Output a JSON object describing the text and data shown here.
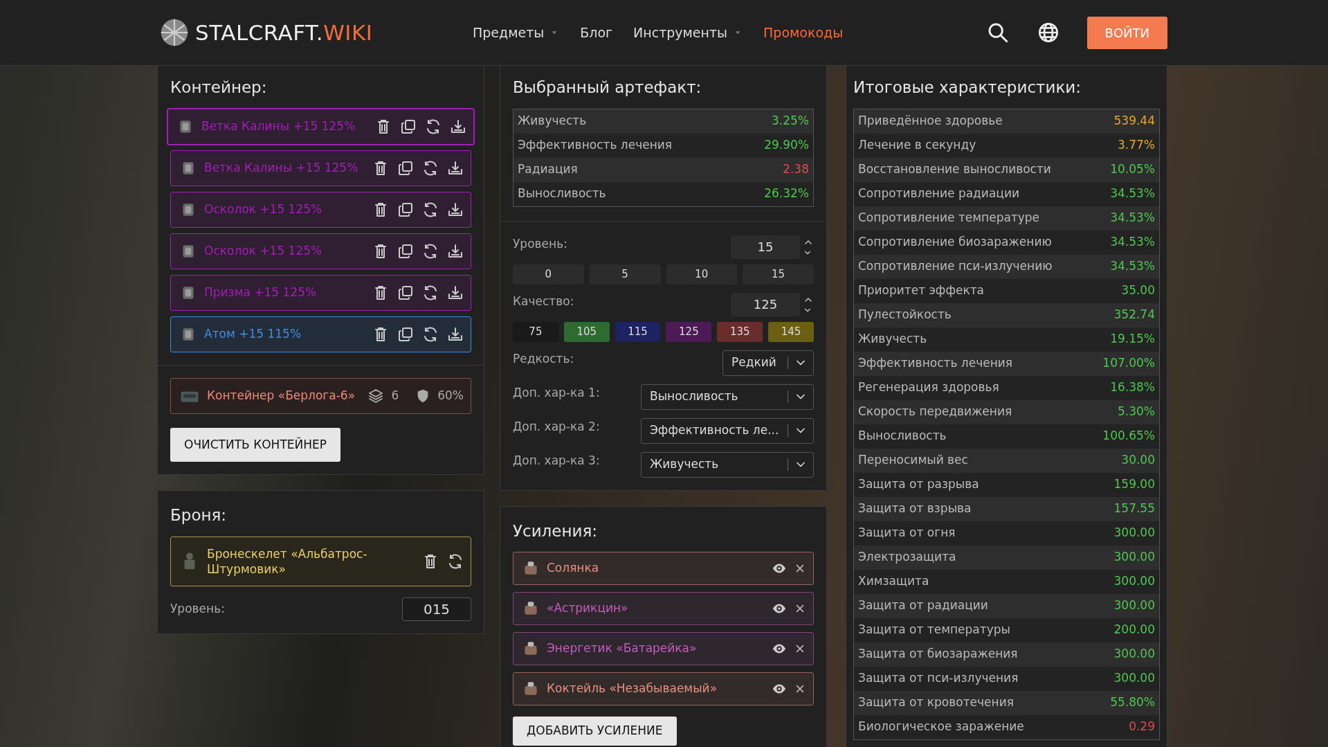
{
  "header": {
    "logo_main": "STALCRAFT.",
    "logo_accent": "WIKI",
    "nav": [
      {
        "label": "Предметы",
        "dropdown": true,
        "highlighted": false
      },
      {
        "label": "Блог",
        "dropdown": false,
        "highlighted": false
      },
      {
        "label": "Инструменты",
        "dropdown": true,
        "highlighted": false
      },
      {
        "label": "Промокоды",
        "dropdown": false,
        "highlighted": true
      }
    ],
    "login": "ВОЙТИ"
  },
  "container": {
    "title": "Контейнер:",
    "items": [
      {
        "name": "Ветка Калины +15 125%",
        "color": "#a21fb5",
        "selected": true
      },
      {
        "name": "Ветка Калины +15 125%",
        "color": "#a21fb5",
        "selected": false
      },
      {
        "name": "Осколок +15 125%",
        "color": "#a21fb5",
        "selected": false
      },
      {
        "name": "Осколок +15 125%",
        "color": "#a21fb5",
        "selected": false
      },
      {
        "name": "Призма +15 125%",
        "color": "#a21fb5",
        "selected": false
      },
      {
        "name": "Атом +15 115%",
        "color": "#3f8ce6",
        "selected": false
      }
    ],
    "box": {
      "name": "Контейнер «Берлога-6»",
      "slots": "6",
      "protection": "60%"
    },
    "clear_button": "ОЧИСТИТЬ КОНТЕЙНЕР"
  },
  "armor": {
    "title": "Броня:",
    "item": "Бронескелет «Альбатрос-Штурмовик»",
    "level_label": "Уровень:",
    "level_value": "015"
  },
  "artifact": {
    "title": "Выбранный артефакт:",
    "stats": [
      {
        "label": "Живучесть",
        "value": "3.25%",
        "kind": "good"
      },
      {
        "label": "Эффективность лечения",
        "value": "29.90%",
        "kind": "good"
      },
      {
        "label": "Радиация",
        "value": "2.38",
        "kind": "bad"
      },
      {
        "label": "Выносливость",
        "value": "26.32%",
        "kind": "good"
      }
    ],
    "level": {
      "label": "Уровень:",
      "value": "15",
      "presets": [
        "0",
        "5",
        "10",
        "15"
      ]
    },
    "quality": {
      "label": "Качество:",
      "value": "125",
      "presets": [
        {
          "label": "75",
          "color": "#1a1a1a"
        },
        {
          "label": "105",
          "color": "#2e6b30"
        },
        {
          "label": "115",
          "color": "#1d2263"
        },
        {
          "label": "125",
          "color": "#4c1a57"
        },
        {
          "label": "135",
          "color": "#6b2c2c"
        },
        {
          "label": "145",
          "color": "#6b5f12"
        }
      ]
    },
    "rarity": {
      "label": "Редкость:",
      "value": "Редкий"
    },
    "extras": [
      {
        "label": "Доп. хар-ка 1:",
        "value": "Выносливость"
      },
      {
        "label": "Доп. хар-ка 2:",
        "value": "Эффективность ле..."
      },
      {
        "label": "Доп. хар-ка 3:",
        "value": "Живучесть"
      }
    ]
  },
  "boosts": {
    "title": "Усиления:",
    "items": [
      {
        "name": "Солянка",
        "color": "#e8907e"
      },
      {
        "name": "«Астрикцин»",
        "color": "#c45cbc"
      },
      {
        "name": "Энергетик «Батарейка»",
        "color": "#c45cbc"
      },
      {
        "name": "Коктейль «Незабываемый»",
        "color": "#e8907e"
      }
    ],
    "add_button": "ДОБАВИТЬ УСИЛЕНИЕ"
  },
  "totals": {
    "title": "Итоговые характеристики:",
    "stats": [
      {
        "label": "Приведённое здоровье",
        "value": "539.44",
        "kind": "gold"
      },
      {
        "label": "Лечение в секунду",
        "value": "3.77%",
        "kind": "gold"
      },
      {
        "label": "Восстановление выносливости",
        "value": "10.05%",
        "kind": "good"
      },
      {
        "label": "Сопротивление радиации",
        "value": "34.53%",
        "kind": "good"
      },
      {
        "label": "Сопротивление температуре",
        "value": "34.53%",
        "kind": "good"
      },
      {
        "label": "Сопротивление биозаражению",
        "value": "34.53%",
        "kind": "good"
      },
      {
        "label": "Сопротивление пси-излучению",
        "value": "34.53%",
        "kind": "good"
      },
      {
        "label": "Приоритет эффекта",
        "value": "35.00",
        "kind": "good"
      },
      {
        "label": "Пулестойкость",
        "value": "352.74",
        "kind": "good"
      },
      {
        "label": "Живучесть",
        "value": "19.15%",
        "kind": "good"
      },
      {
        "label": "Эффективность лечения",
        "value": "107.00%",
        "kind": "good"
      },
      {
        "label": "Регенерация здоровья",
        "value": "16.38%",
        "kind": "good"
      },
      {
        "label": "Скорость передвижения",
        "value": "5.30%",
        "kind": "good"
      },
      {
        "label": "Выносливость",
        "value": "100.65%",
        "kind": "good"
      },
      {
        "label": "Переносимый вес",
        "value": "30.00",
        "kind": "good"
      },
      {
        "label": "Защита от разрыва",
        "value": "159.00",
        "kind": "good"
      },
      {
        "label": "Защита от взрыва",
        "value": "157.55",
        "kind": "good"
      },
      {
        "label": "Защита от огня",
        "value": "300.00",
        "kind": "good"
      },
      {
        "label": "Электрозащита",
        "value": "300.00",
        "kind": "good"
      },
      {
        "label": "Химзащита",
        "value": "300.00",
        "kind": "good"
      },
      {
        "label": "Защита от радиации",
        "value": "300.00",
        "kind": "good"
      },
      {
        "label": "Защита от температуры",
        "value": "200.00",
        "kind": "good"
      },
      {
        "label": "Защита от биозаражения",
        "value": "300.00",
        "kind": "good"
      },
      {
        "label": "Защита от пси-излучения",
        "value": "300.00",
        "kind": "good"
      },
      {
        "label": "Защита от кровотечения",
        "value": "55.80%",
        "kind": "good"
      },
      {
        "label": "Биологическое заражение",
        "value": "0.29",
        "kind": "bad"
      }
    ]
  }
}
